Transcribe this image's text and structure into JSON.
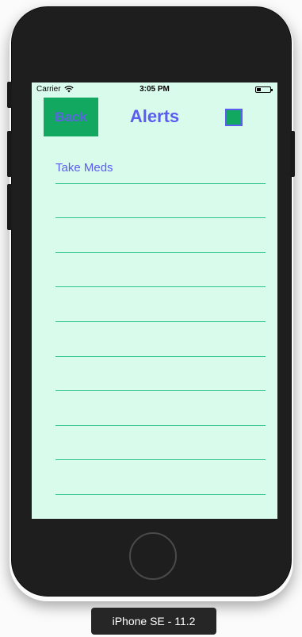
{
  "status_bar": {
    "carrier": "Carrier",
    "time": "3:05 PM"
  },
  "nav": {
    "back_label": "Back",
    "title": "Alerts"
  },
  "alerts": {
    "rows": [
      "Take Meds",
      "",
      "",
      "",
      "",
      "",
      "",
      "",
      "",
      ""
    ]
  },
  "device": {
    "label": "iPhone SE - 11.2"
  },
  "colors": {
    "screen_bg": "#d9fbec",
    "accent_green": "#13a85f",
    "accent_blue": "#5b5cf0",
    "separator": "#2ec38a"
  }
}
